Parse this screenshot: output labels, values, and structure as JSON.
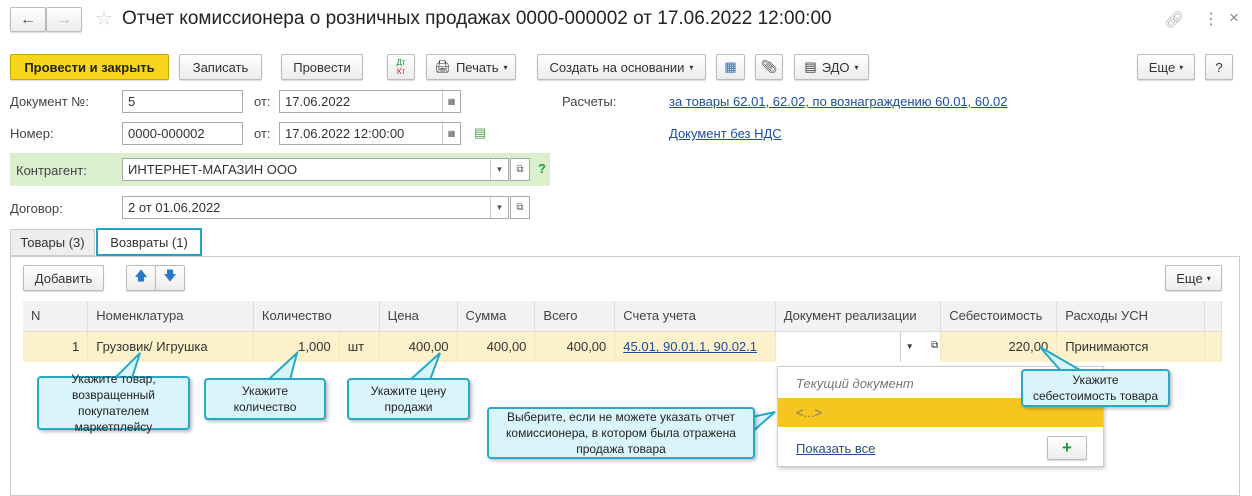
{
  "window": {
    "title": "Отчет комиссионера о розничных продажах 0000-000002 от 17.06.2022 12:00:00"
  },
  "toolbar": {
    "post_close": "Провести и закрыть",
    "save": "Записать",
    "post": "Провести",
    "dtkt_dt": "Дт",
    "dtkt_kt": "Кт",
    "print": "Печать",
    "create_based": "Создать на основании",
    "edo": "ЭДО",
    "more": "Еще",
    "help": "?"
  },
  "form": {
    "doc_no_label": "Документ №:",
    "doc_no": "5",
    "from_label": "от:",
    "doc_date": "17.06.2022",
    "number_label": "Номер:",
    "number": "0000-000002",
    "number_date": "17.06.2022 12:00:00",
    "settlements_label": "Расчеты:",
    "settlements_link": "за товары 62.01, 62.02, по вознаграждению 60.01, 60.02",
    "vat_link": "Документ без НДС",
    "counterparty_label": "Контрагент:",
    "counterparty": "ИНТЕРНЕТ-МАГАЗИН ООО",
    "help": "?",
    "contract_label": "Договор:",
    "contract": "2 от 01.06.2022"
  },
  "tabs": [
    {
      "label": "Товары (3)"
    },
    {
      "label": "Возвраты (1)"
    }
  ],
  "table_toolbar": {
    "add": "Добавить",
    "more": "Еще"
  },
  "table": {
    "columns": [
      "N",
      "Номенклатура",
      "Количество",
      "Цена",
      "Сумма",
      "Всего",
      "Счета учета",
      "Документ реализации",
      "Себестоимость",
      "Расходы УСН"
    ],
    "rows": [
      {
        "n": "1",
        "item": "Грузовик/ Игрушка",
        "qty": "1,000",
        "unit": "шт",
        "price": "400,00",
        "sum": "400,00",
        "total": "400,00",
        "accounts": "45.01, 90.01.1, 90.02.1",
        "doc": "",
        "cost": "220,00",
        "usn": "Принимаются"
      }
    ]
  },
  "dropdown": {
    "current": "Текущий документ",
    "empty": "<...>",
    "show_all": "Показать все",
    "add": "+"
  },
  "callouts": {
    "item": "Укажите товар, возвращенный покупателем маркетплейсу",
    "qty": "Укажите количество",
    "price": "Укажите цену продажи",
    "doc": "Выберите, если не можете указать отчет комиссионера, в котором была отражена продажа товара",
    "cost": "Укажите себестоимость товара"
  }
}
